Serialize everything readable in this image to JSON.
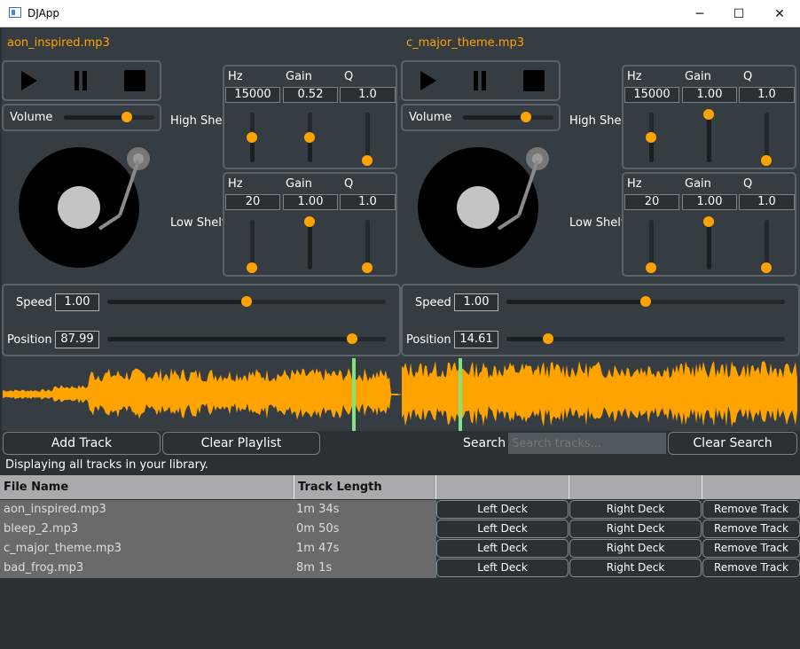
{
  "window": {
    "title": "DJApp",
    "minimize": "─",
    "maximize": "☐",
    "close": "✕"
  },
  "colors": {
    "accent": "#ffa300",
    "playhead": "#7fe37f",
    "panel": "#353d43",
    "background": "#2a3034"
  },
  "decks": [
    {
      "file": "aon_inspired.mp3",
      "volume_label": "Volume",
      "volume": 0.7,
      "high_shelf": {
        "label": "High Shelf",
        "headers": [
          "Hz",
          "Gain",
          "Q"
        ],
        "values": [
          "15000",
          "0.52",
          "1.0"
        ],
        "levels": [
          0.5,
          0.5,
          0.0
        ]
      },
      "low_shelf": {
        "label": "Low Shelf",
        "headers": [
          "Hz",
          "Gain",
          "Q"
        ],
        "values": [
          "20",
          "1.00",
          "1.0"
        ],
        "levels": [
          0.0,
          1.0,
          0.0
        ]
      },
      "speed_label": "Speed",
      "speed": "1.00",
      "speed_level": 0.5,
      "position_label": "Position",
      "position": "87.99",
      "position_level": 0.88,
      "playhead": 0.9
    },
    {
      "file": "c_major_theme.mp3",
      "volume_label": "Volume",
      "volume": 0.7,
      "high_shelf": {
        "label": "High Shelf",
        "headers": [
          "Hz",
          "Gain",
          "Q"
        ],
        "values": [
          "15000",
          "1.00",
          "1.0"
        ],
        "levels": [
          0.5,
          1.0,
          0.0
        ]
      },
      "low_shelf": {
        "label": "Low Shelf",
        "headers": [
          "Hz",
          "Gain",
          "Q"
        ],
        "values": [
          "20",
          "1.00",
          "1.0"
        ],
        "levels": [
          0.0,
          1.0,
          0.0
        ]
      },
      "speed_label": "Speed",
      "speed": "1.00",
      "speed_level": 0.5,
      "position_label": "Position",
      "position": "14.61",
      "position_level": 0.15,
      "playhead": 0.15
    }
  ],
  "playlist": {
    "add_track": "Add Track",
    "clear_playlist": "Clear Playlist",
    "search_label": "Search",
    "search_placeholder": "Search tracks...",
    "clear_search": "Clear Search",
    "status": "Displaying all tracks in your library.",
    "columns": [
      "File Name",
      "Track Length",
      "",
      "",
      ""
    ],
    "rows": [
      {
        "name": "aon_inspired.mp3",
        "length": "1m 34s"
      },
      {
        "name": "bleep_2.mp3",
        "length": "0m 50s"
      },
      {
        "name": "c_major_theme.mp3",
        "length": "1m 47s"
      },
      {
        "name": "bad_frog.mp3",
        "length": "8m 1s"
      }
    ],
    "row_buttons": {
      "left": "Left Deck",
      "right": "Right Deck",
      "remove": "Remove Track"
    }
  }
}
